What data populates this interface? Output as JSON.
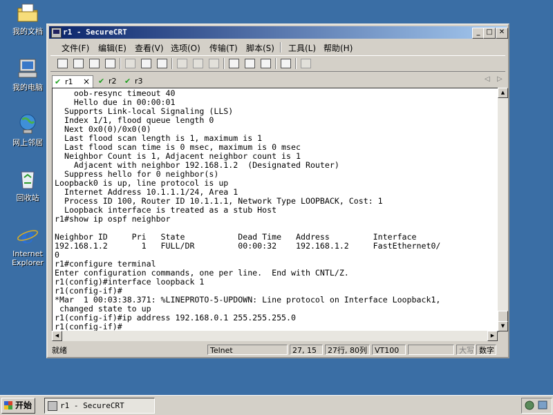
{
  "colors": {
    "desktop": "#3a6ea5",
    "titlebar_start": "#0a246a",
    "titlebar_end": "#a6caf0",
    "tab_check": "#20a020"
  },
  "desktop": {
    "icons": [
      {
        "label": "我的文档",
        "icon": "my-documents-icon"
      },
      {
        "label": "我的电脑",
        "icon": "my-computer-icon"
      },
      {
        "label": "网上邻居",
        "icon": "network-places-icon"
      },
      {
        "label": "回收站",
        "icon": "recycle-bin-icon"
      },
      {
        "label_line1": "Internet",
        "label_line2": "Explorer",
        "icon": "internet-explorer-icon"
      }
    ]
  },
  "window": {
    "title": "r1 - SecureCRT",
    "controls": {
      "minimize": "_",
      "maximize": "□",
      "close": "✕"
    }
  },
  "menu": [
    "文件(F)",
    "编辑(E)",
    "查看(V)",
    "选项(O)",
    "传输(T)",
    "脚本(S)",
    "工具(L)",
    "帮助(H)"
  ],
  "toolbar": {
    "icons": [
      "connect-icon",
      "quick-connect-icon",
      "connect-tab-icon",
      "disconnect-icon",
      "copy-icon",
      "paste-icon",
      "find-icon",
      "print-icon",
      "print-selection-icon",
      "print-setup-icon",
      "session-options-icon",
      "global-options-icon",
      "keymap-icon",
      "help-icon",
      "sftp-icon"
    ]
  },
  "tabs": [
    {
      "label": "r1",
      "close": "×",
      "active": true
    },
    {
      "label": "r2",
      "active": false
    },
    {
      "label": "r3",
      "active": false
    }
  ],
  "terminal": {
    "lines": [
      "    oob-resync timeout 40",
      "    Hello due in 00:00:01",
      "  Supports Link-local Signaling (LLS)",
      "  Index 1/1, flood queue length 0",
      "  Next 0x0(0)/0x0(0)",
      "  Last flood scan length is 1, maximum is 1",
      "  Last flood scan time is 0 msec, maximum is 0 msec",
      "  Neighbor Count is 1, Adjacent neighbor count is 1",
      "    Adjacent with neighbor 192.168.1.2  (Designated Router)",
      "  Suppress hello for 0 neighbor(s)",
      "Loopback0 is up, line protocol is up",
      "  Internet Address 10.1.1.1/24, Area 1",
      "  Process ID 100, Router ID 10.1.1.1, Network Type LOOPBACK, Cost: 1",
      "  Loopback interface is treated as a stub Host",
      "r1#show ip ospf neighbor",
      "",
      "Neighbor ID     Pri   State           Dead Time   Address         Interface",
      "192.168.1.2       1   FULL/DR         00:00:32    192.168.1.2     FastEthernet0/",
      "0",
      "r1#configure terminal",
      "Enter configuration commands, one per line.  End with CNTL/Z.",
      "r1(config)#interface loopback 1",
      "r1(config-if)#",
      "*Mar  1 00:03:38.371: %LINEPROTO-5-UPDOWN: Line protocol on Interface Loopback1,",
      " changed state to up",
      "r1(config-if)#ip address 192.168.0.1 255.255.255.0",
      "r1(config-if)#"
    ]
  },
  "statusbar": {
    "ready": "就绪",
    "protocol": "Telnet",
    "cursor": "27, 15",
    "size": "27行, 80列",
    "emulation": "VT100",
    "caps": "大写",
    "num": "数字"
  },
  "taskbar": {
    "start": "开始",
    "task": "r1 - SecureCRT"
  }
}
